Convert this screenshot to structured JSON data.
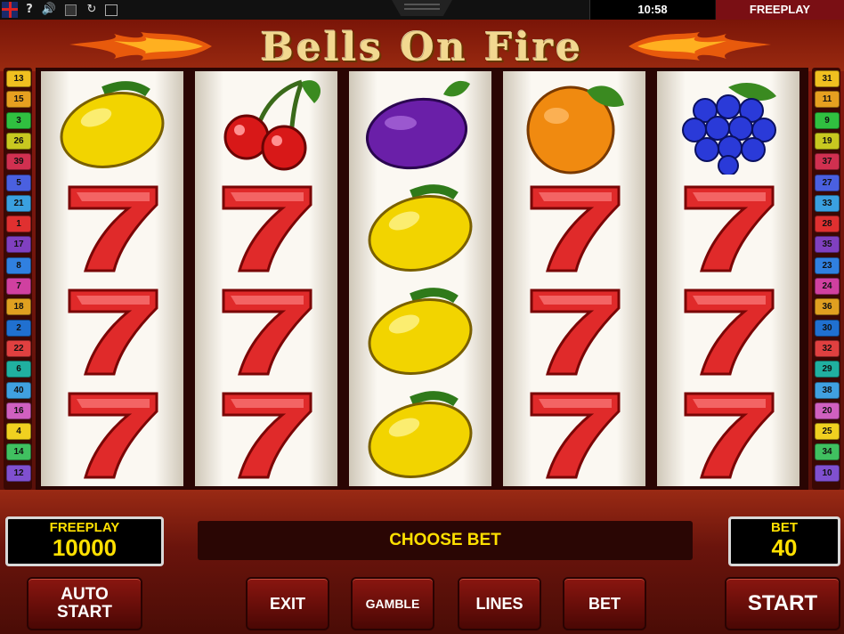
{
  "topbar": {
    "time": "10:58",
    "freeplay_label": "FREEPLAY",
    "help_label": "?"
  },
  "game": {
    "title": "Bells On Fire"
  },
  "paylines": {
    "left": [
      "13",
      "15",
      "3",
      "26",
      "39",
      "5",
      "21",
      "1",
      "17",
      "8",
      "7",
      "18",
      "2",
      "22",
      "6",
      "40",
      "16",
      "4",
      "14",
      "12"
    ],
    "right": [
      "31",
      "11",
      "9",
      "19",
      "37",
      "27",
      "33",
      "28",
      "35",
      "23",
      "24",
      "36",
      "30",
      "32",
      "29",
      "38",
      "20",
      "25",
      "34",
      "10"
    ]
  },
  "reels": [
    [
      "lemon",
      "seven",
      "seven",
      "seven"
    ],
    [
      "cherry",
      "seven",
      "seven",
      "seven"
    ],
    [
      "plum",
      "lemon",
      "lemon",
      "lemon"
    ],
    [
      "orange",
      "seven",
      "seven",
      "seven"
    ],
    [
      "grapes",
      "seven",
      "seven",
      "seven"
    ]
  ],
  "panel": {
    "freeplay_label": "FREEPLAY",
    "freeplay_value": "10000",
    "message": "CHOOSE BET",
    "bet_label": "BET",
    "bet_value": "40"
  },
  "buttons": {
    "auto_line1": "AUTO",
    "auto_line2": "START",
    "exit": "EXIT",
    "gamble": "GAMBLE",
    "lines": "LINES",
    "bet": "BET",
    "start": "START"
  },
  "colors": {
    "frame": "#8b1a10",
    "accent_yellow": "#ffe000",
    "title_gold": "#f2d890"
  }
}
